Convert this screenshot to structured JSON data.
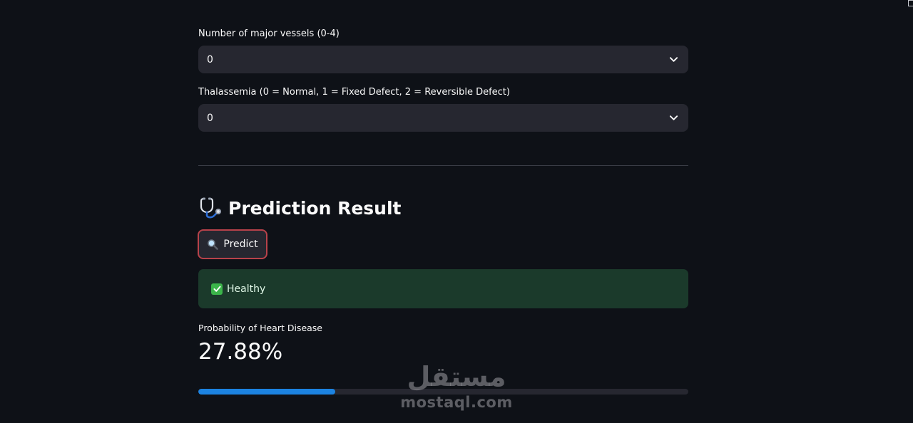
{
  "form": {
    "vessels_field": {
      "label": "Number of major vessels (0-4)",
      "value": "0",
      "icon": "chevron-down-icon"
    },
    "thal_field": {
      "label": "Thalassemia (0 = Normal, 1 = Fixed Defect, 2 = Reversible Defect)",
      "value": "0",
      "icon": "chevron-down-icon"
    }
  },
  "result_section": {
    "icon": "stethoscope-icon",
    "heading": "Prediction Result",
    "predict_button": {
      "icon": "magnifier-icon",
      "label": "Predict"
    },
    "alert": {
      "icon": "check-mark-icon",
      "text": "Healthy",
      "color": "#1b3a2b"
    },
    "metric": {
      "label": "Probability of Heart Disease",
      "value": "27.88%"
    },
    "progress": {
      "fraction": 0.2788,
      "color": "#1c83e1"
    }
  },
  "watermark": {
    "arabic": "مستقل",
    "latin": "mostaql.com"
  },
  "colors": {
    "background": "#0e1117",
    "widget": "#262730",
    "button_border": "#b8424a"
  }
}
